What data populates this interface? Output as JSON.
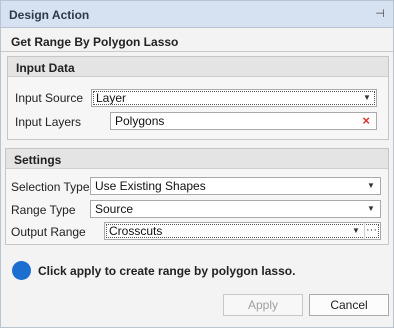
{
  "window": {
    "title": "Design Action",
    "pin_glyph": "⊣"
  },
  "header": {
    "subtitle": "Get Range By Polygon Lasso"
  },
  "input_data": {
    "heading": "Input Data",
    "input_source_label": "Input Source",
    "input_source_value": "Layer",
    "input_layers_label": "Input Layers",
    "input_layers_value": "Polygons"
  },
  "settings": {
    "heading": "Settings",
    "selection_type_label": "Selection Type",
    "selection_type_value": "Use Existing Shapes",
    "range_type_label": "Range Type",
    "range_type_value": "Source",
    "output_range_label": "Output Range",
    "output_range_value": "Crosscuts"
  },
  "info": {
    "message": "Click apply to create range by polygon lasso.",
    "icon": "info-circle-icon",
    "color": "#1c6fd1"
  },
  "footer": {
    "apply_label": "Apply",
    "cancel_label": "Cancel"
  },
  "glyphs": {
    "dropdown": "▼",
    "clear": "×",
    "ellipsis": "···"
  }
}
